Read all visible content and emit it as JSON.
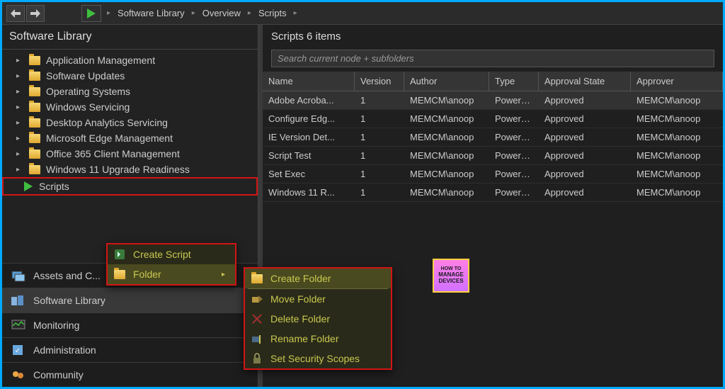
{
  "breadcrumb": [
    "Software Library",
    "Overview",
    "Scripts"
  ],
  "leftPanel": {
    "title": "Software Library",
    "tree": [
      "Application Management",
      "Software Updates",
      "Operating Systems",
      "Windows Servicing",
      "Desktop Analytics Servicing",
      "Microsoft Edge Management",
      "Office 365 Client Management",
      "Windows 11 Upgrade Readiness"
    ],
    "scriptsLabel": "Scripts"
  },
  "workspaces": [
    {
      "id": "assets",
      "label": "Assets and C..."
    },
    {
      "id": "library",
      "label": "Software Library"
    },
    {
      "id": "monitoring",
      "label": "Monitoring"
    },
    {
      "id": "admin",
      "label": "Administration"
    },
    {
      "id": "community",
      "label": "Community"
    }
  ],
  "content": {
    "title": "Scripts 6 items",
    "searchPlaceholder": "Search current node + subfolders",
    "columns": [
      "Name",
      "Version",
      "Author",
      "Type",
      "Approval State",
      "Approver"
    ],
    "rows": [
      {
        "name": "Adobe Acroba...",
        "version": "1",
        "author": "MEMCM\\anoop",
        "type": "PowerS...",
        "state": "Approved",
        "approver": "MEMCM\\anoop"
      },
      {
        "name": "Configure Edg...",
        "version": "1",
        "author": "MEMCM\\anoop",
        "type": "PowerS...",
        "state": "Approved",
        "approver": "MEMCM\\anoop"
      },
      {
        "name": "IE Version Det...",
        "version": "1",
        "author": "MEMCM\\anoop",
        "type": "PowerS...",
        "state": "Approved",
        "approver": "MEMCM\\anoop"
      },
      {
        "name": "Script Test",
        "version": "1",
        "author": "MEMCM\\anoop",
        "type": "PowerS...",
        "state": "Approved",
        "approver": "MEMCM\\anoop"
      },
      {
        "name": "Set Exec",
        "version": "1",
        "author": "MEMCM\\anoop",
        "type": "PowerS...",
        "state": "Approved",
        "approver": "MEMCM\\anoop"
      },
      {
        "name": "Windows 11 R...",
        "version": "1",
        "author": "MEMCM\\anoop",
        "type": "PowerS...",
        "state": "Approved",
        "approver": "MEMCM\\anoop"
      }
    ]
  },
  "ctxMenu1": [
    {
      "icon": "script",
      "label": "Create Script"
    },
    {
      "icon": "folder",
      "label": "Folder",
      "hasSubmenu": true,
      "hover": true
    }
  ],
  "ctxMenu2": [
    {
      "icon": "folder",
      "label": "Create Folder",
      "hover": true
    },
    {
      "icon": "move",
      "label": "Move Folder"
    },
    {
      "icon": "delete",
      "label": "Delete Folder"
    },
    {
      "icon": "rename",
      "label": "Rename Folder"
    },
    {
      "icon": "lock",
      "label": "Set Security Scopes"
    }
  ],
  "badge": {
    "line1": "HOW TO",
    "line2": "MANAGE",
    "line3": "DEVICES"
  }
}
